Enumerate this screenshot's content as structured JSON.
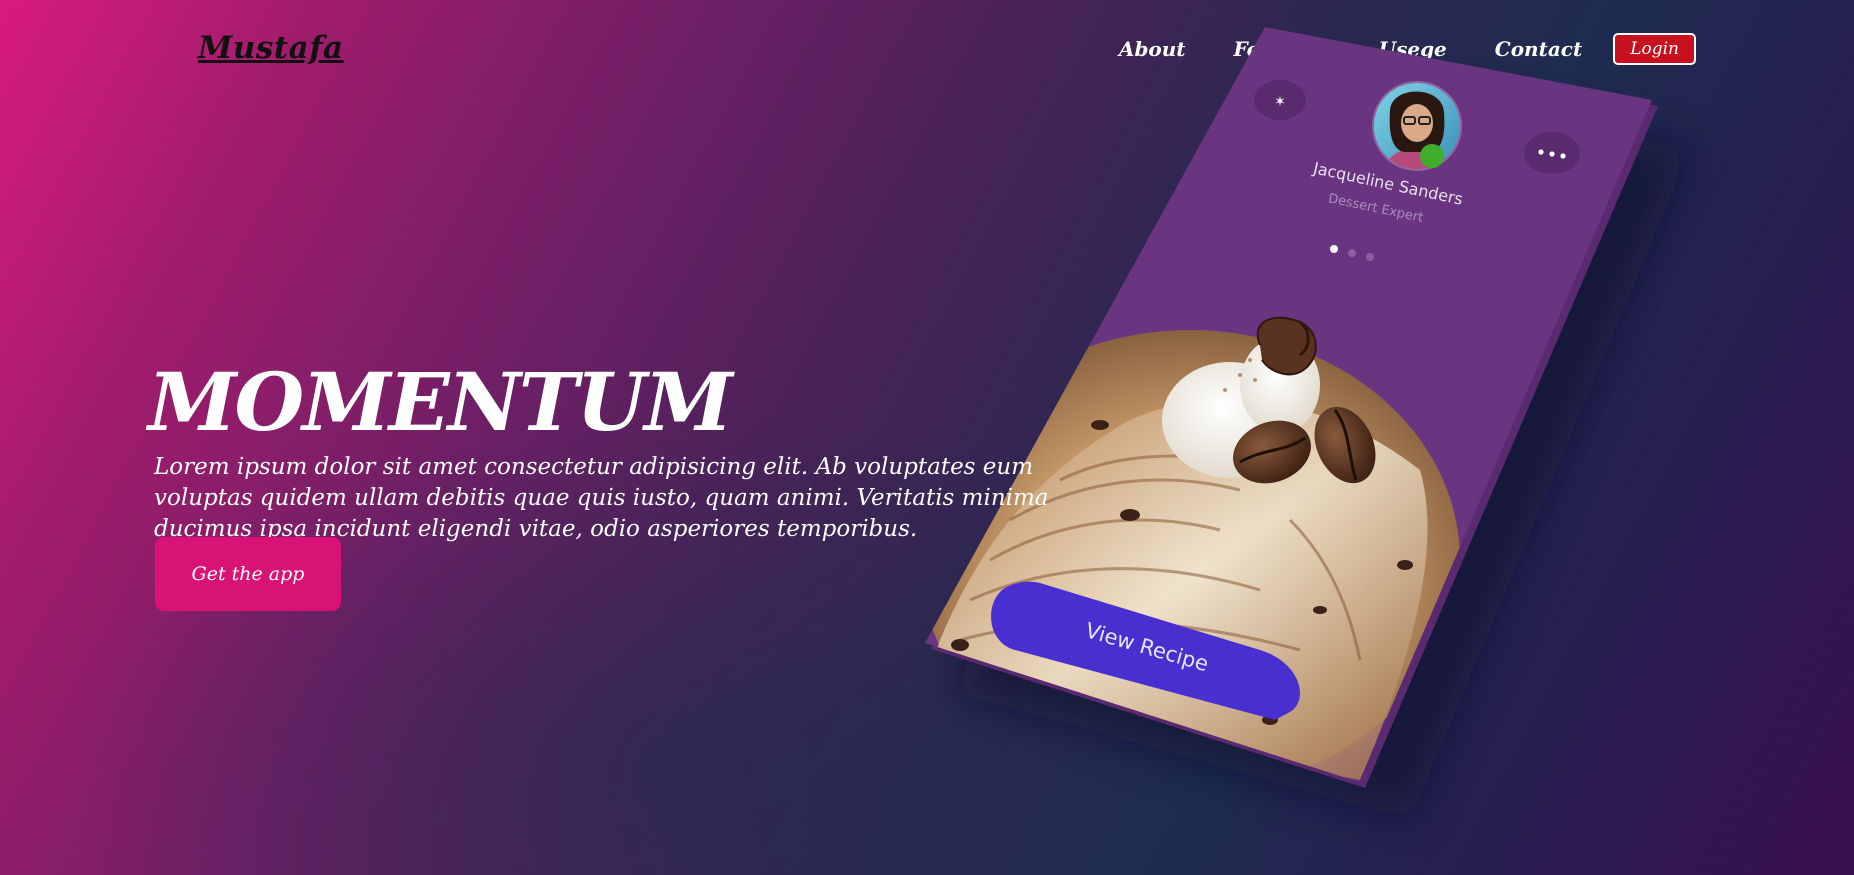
{
  "brand": {
    "logo": "Mustafa"
  },
  "nav": {
    "links": [
      "About",
      "Features",
      "Usege",
      "Contact"
    ],
    "login_label": "Login"
  },
  "hero": {
    "title": "MOMENTUM",
    "text": "Lorem ipsum dolor sit amet consectetur adipisicing elit. Ab voluptates eum voluptas quidem ullam debitis quae quis iusto, quam animi. Veritatis minima ducimus ipsa incidunt eligendi vitae, odio asperiores temporibus.",
    "cta_label": "Get the app"
  },
  "phone": {
    "profile_name": "Jacqueline Sanders",
    "profile_role": "Dessert Expert",
    "button_label": "View Recipe",
    "status_color": "#3fae2a",
    "screen_color": "#6a3580",
    "button_color": "#4a2fd0",
    "icons": [
      "star-icon",
      "more-icon",
      "avatar",
      "ice-cream-image"
    ]
  },
  "colors": {
    "cta": "#d91376",
    "login": "#c8111e",
    "gradient_start": "#d81b7e",
    "gradient_end": "#3a0f4f"
  }
}
